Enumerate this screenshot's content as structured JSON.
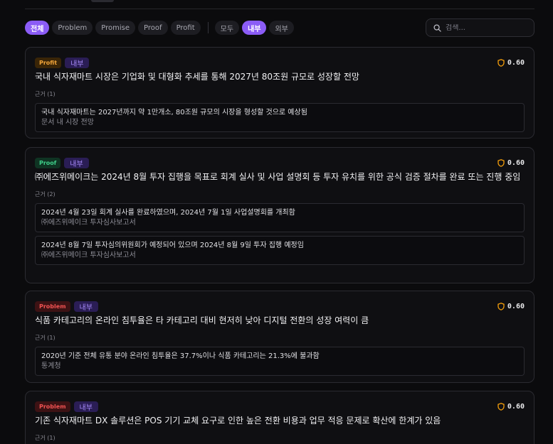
{
  "filters": {
    "types": [
      "전체",
      "Problem",
      "Promise",
      "Proof",
      "Profit"
    ],
    "active_type": "전체",
    "scopes": [
      "모두",
      "내부",
      "외부"
    ],
    "active_scope": "내부"
  },
  "search": {
    "placeholder": "검색..."
  },
  "colors": {
    "accent": "#8b5cf6",
    "profit": "#f4a63a",
    "proof": "#3fcf8a",
    "problem": "#f05252",
    "score_icon": "#f59e0b"
  },
  "cards": [
    {
      "type": "Profit",
      "scope": "내부",
      "score": "0.60",
      "claim": "국내 식자재마트 시장은 기업화 및 대형화 추세를 통해 2027년 80조원 규모로 성장할 전망",
      "evidence_label": "근거 (1)",
      "evidence": [
        {
          "text": "국내 식자재마트는 2027년까지 약 1만개소, 80조원 규모의 시장을 형성할 것으로 예상됨",
          "source": "문서 내 시장 전망"
        }
      ]
    },
    {
      "type": "Proof",
      "scope": "내부",
      "score": "0.60",
      "claim": "㈜에즈위메이크는 2024년 8월 투자 집행을 목표로 회계 실사 및 사업 설명회 등 투자 유치를 위한 공식 검증 절차를 완료 또는 진행 중임",
      "evidence_label": "근거 (2)",
      "evidence": [
        {
          "text": "2024년 4월 23일 회계 실사를 완료하였으며, 2024년 7월 1일 사업설명회를 개최함",
          "source": "㈜에즈위메이크 투자심사보고서"
        },
        {
          "text": "2024년 8월 7일 투자심의위원회가 예정되어 있으며 2024년 8월 9일 투자 집행 예정임",
          "source": "㈜에즈위메이크 투자심사보고서"
        }
      ]
    },
    {
      "type": "Problem",
      "scope": "내부",
      "score": "0.60",
      "claim": "식품 카테고리의 온라인 침투율은 타 카테고리 대비 현저히 낮아 디지털 전환의 성장 여력이 큼",
      "evidence_label": "근거 (1)",
      "evidence": [
        {
          "text": "2020년 기준 전체 유통 분야 온라인 침투율은 37.7%이나 식품 카테고리는 21.3%에 불과함",
          "source": "통계청"
        }
      ]
    },
    {
      "type": "Problem",
      "scope": "내부",
      "score": "0.60",
      "claim": "기존 식자재마트 DX 솔루션은 POS 기기 교체 요구로 인한 높은 전환 비용과 업무 적응 문제로 확산에 한계가 있음",
      "evidence_label": "근거 (1)",
      "evidence": []
    }
  ]
}
